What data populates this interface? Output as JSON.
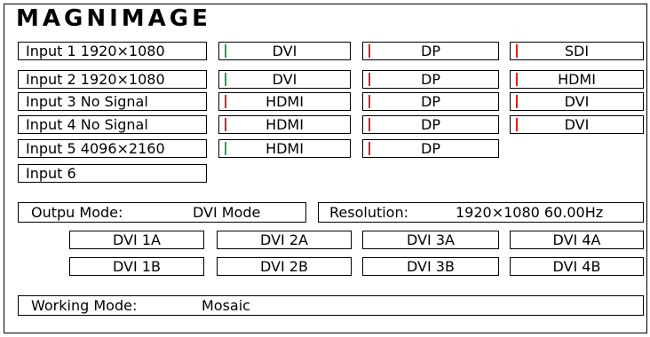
{
  "brand": "MAGNIMAGE",
  "colors": {
    "signal_ok": "#1aa84a",
    "signal_none": "#e0201c"
  },
  "inputs": [
    {
      "label": "Input 1 1920×1080",
      "signals": [
        {
          "name": "DVI",
          "active": true
        },
        {
          "name": "DP",
          "active": false
        },
        {
          "name": "SDI",
          "active": false
        }
      ]
    },
    {
      "label": "Input 2 1920×1080",
      "signals": [
        {
          "name": "DVI",
          "active": true
        },
        {
          "name": "DP",
          "active": false
        },
        {
          "name": "HDMI",
          "active": false
        }
      ]
    },
    {
      "label": "Input 3 No Signal",
      "signals": [
        {
          "name": "HDMI",
          "active": false
        },
        {
          "name": "DP",
          "active": false
        },
        {
          "name": "DVI",
          "active": false
        }
      ]
    },
    {
      "label": "Input 4 No Signal",
      "signals": [
        {
          "name": "HDMI",
          "active": false
        },
        {
          "name": "DP",
          "active": false
        },
        {
          "name": "DVI",
          "active": false
        }
      ]
    },
    {
      "label": "Input 5 4096×2160",
      "signals": [
        {
          "name": "HDMI",
          "active": true
        },
        {
          "name": "DP",
          "active": false
        }
      ]
    },
    {
      "label": "Input 6",
      "signals": []
    }
  ],
  "output": {
    "mode_label": "Outpu Mode:",
    "mode_value": "DVI Mode",
    "resolution_label": "Resolution:",
    "resolution_value": "1920×1080 60.00Hz"
  },
  "dvi_ports": [
    [
      "DVI 1A",
      "DVI 2A",
      "DVI 3A",
      "DVI 4A"
    ],
    [
      "DVI 1B",
      "DVI 2B",
      "DVI 3B",
      "DVI 4B"
    ]
  ],
  "working": {
    "label": "Working Mode:",
    "value": "Mosaic"
  }
}
